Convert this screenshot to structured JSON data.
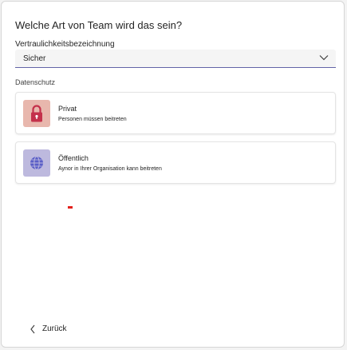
{
  "dialog": {
    "title": "Welche Art von Team wird das sein?",
    "sensitivity_label": "Vertraulichkeitsbezeichnung",
    "sensitivity_select": {
      "value": "Sicher",
      "icon": "chevron-down-icon"
    },
    "privacy_label": "Datenschutz",
    "options": [
      {
        "title": "Privat",
        "description": "Personen müssen beitreten",
        "icon": "lock-icon",
        "icon_bg": "#e8b7ad"
      },
      {
        "title": "Öffentlich",
        "description": "Aynor in Ihrer Organisation kann beitreten",
        "icon": "globe-icon",
        "icon_bg": "#bdb9de"
      }
    ],
    "back": {
      "label": "Zurück",
      "icon": "chevron-left-icon"
    }
  },
  "colors": {
    "accent": "#6264a7",
    "marker": "#e3211c"
  }
}
